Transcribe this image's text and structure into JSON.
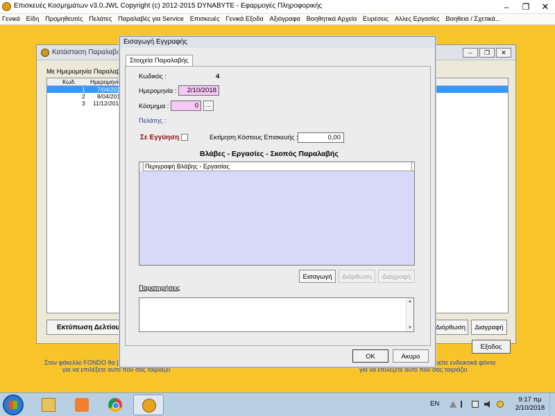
{
  "app": {
    "title": "Επισκευές Κοσμημάτων  v3.0.JWL     Copyright (c) 2012-2015  DYNABYTE - Εφαρμογές Πληροφορικής",
    "controls": {
      "minimize": "–",
      "maximize": "❐",
      "close": "✕"
    }
  },
  "menu": [
    "Γενικά",
    "Είδη",
    "Προμηθευτές",
    "Πελάτες",
    "Παραλαβές για Service",
    "Επισκευές",
    "Γενικά Εξοδα",
    "Αξιόγραφα",
    "Βοηθητικά Αρχεία",
    "Ευρέσεις",
    "Αλλες Εργασίες",
    "Βοηθεια / Σχετικά..."
  ],
  "background_window": {
    "title": "Κατάσταση Παραλαβών",
    "filter_label": "Με Ημερομηνία Παραλαβής",
    "columns": [
      "Κωδ.",
      "Ημερομηνία"
    ],
    "rows": [
      {
        "code": "1",
        "date": "7/04/2018",
        "selected": true
      },
      {
        "code": "2",
        "date": "8/04/2018",
        "selected": false
      },
      {
        "code": "3",
        "date": "11/12/2018",
        "selected": false
      }
    ],
    "print_button": "Εκτύπωση Δελτίου Παραλαβής",
    "edit_button": "Διόρθωση",
    "delete_button": "Διαγραφή",
    "exit_button": "Εξοδος"
  },
  "faded_hints": {
    "left_line1": "Στον φάκελλο FONDO θα βρείτε ενδεικτικά φόντα",
    "left_line2": "για να επιλέξετε αυτό που σας ταιριάζει",
    "right_line1": "Στον φάκελλο FONDO θα βρείτε ενδεικτικά φόντα",
    "right_line2": "για να επιλέξετε αυτό που σας ταιριάζει"
  },
  "dialog": {
    "title": "Εισαγωγή Εγγραφής",
    "tab": "Στοιχεία Παραλαβής",
    "code_label": "Κωδικός :",
    "code_value": "4",
    "date_label": "Ημερομηνία :",
    "date_value": "2/10/2018",
    "jewel_label": "Κόσμημα :",
    "jewel_value": "0",
    "jewel_lookup": "...",
    "customer_label": "Πελάτης :",
    "warranty_label": "Σε Εγγύηση",
    "warranty_checked": false,
    "estimate_label": "Εκτίμηση Κόστους Επισκευής :",
    "estimate_value": "0,00",
    "section_title": "Βλάβες - Εργασίες - Σκοπός Παραλαβής",
    "grid_column": "Περιγραφή Βλάβης - Εργασίας",
    "insert_button": "Εισαγωγή",
    "edit_button": "Διόρθωση",
    "delete_button": "Διαγραφή",
    "notes_label": "Παρατηρήσεις",
    "notes_value": "",
    "ok_button": "OK",
    "cancel_button": "Ακυρο"
  },
  "taskbar": {
    "apps": [
      "folder-icon",
      "media-player-icon",
      "chrome-icon",
      "repair-app-icon"
    ],
    "lang": "EN",
    "time": "9:17 πμ",
    "date": "2/10/2018"
  }
}
